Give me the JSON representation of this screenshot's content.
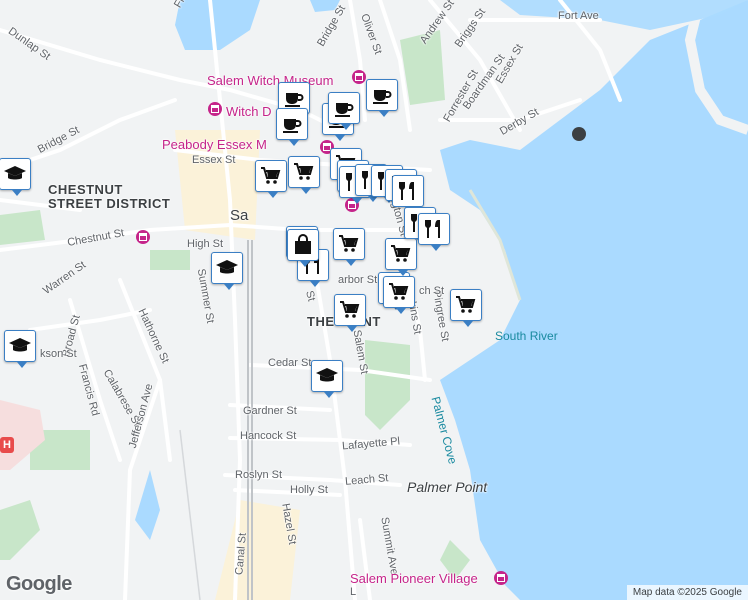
{
  "streets": {
    "franklin": "Franklin",
    "dunlap": "Dunlap St",
    "bridge_nw": "Bridge St",
    "bridge_n": "Bridge St",
    "oliver": "Oliver St",
    "andrew": "Andrew St",
    "briggs": "Briggs St",
    "boardman": "Boardman St",
    "forrester": "Forrester St",
    "essex_ne": "Essex St",
    "fort_ave": "Fort Ave",
    "derby": "Derby St",
    "essex": "Essex St",
    "chestnut": "Chestnut St",
    "high": "High St",
    "warren": "Warren St",
    "summer": "Summer St",
    "hathorne": "Hathorne St",
    "broad": "Broad St",
    "jackson": "kson St",
    "francis": "Francis Rd",
    "calabrese": "Calabrese St",
    "jefferson": "Jefferson Ave",
    "cedar": "Cedar St",
    "salem": "Salem St",
    "gardner": "Gardner St",
    "hancock": "Hancock St",
    "lafayette_pl": "Lafayette Pl",
    "roslyn": "Roslyn St",
    "leach": "Leach St",
    "holly": "Holly St",
    "summit": "Summit Ave",
    "hazel": "Hazel St",
    "canal": "Canal St",
    "pingree": "Pingree St",
    "perkins": "rkins St",
    "harbor": "arbor St",
    "ch": "ch St",
    "lafayette": "ngton St",
    "st": "St",
    "l": "L",
    "sa": "Sa",
    "u": "U"
  },
  "pois": {
    "witch_museum": "Salem Witch Museum",
    "witch_d": "Witch D",
    "peabody": "Peabody Essex M",
    "pioneer": "Salem Pioneer Village"
  },
  "areas": {
    "chestnut_1": "CHESTNUT",
    "chestnut_2": "STREET DISTRICT",
    "the_point": "THE POINT",
    "palmer_point": "Palmer Point",
    "south_river": "South River",
    "palmer_cove": "Palmer Cove"
  },
  "branding": {
    "logo": "Google",
    "attribution": "Map data ©2025 Google",
    "hospital_glyph": "H"
  },
  "colors": {
    "water": "#aadaff",
    "park": "#c8e6c9",
    "road": "#ffffff",
    "pin_border": "#3b7fc4",
    "museum": "#c5248a"
  },
  "markers": [
    {
      "icon": "coffee-icon"
    },
    {
      "icon": "coffee-icon"
    },
    {
      "icon": "coffee-icon"
    },
    {
      "icon": "coffee-icon"
    },
    {
      "icon": "coffee-icon"
    },
    {
      "icon": "grocery-cart-icon"
    },
    {
      "icon": "grocery-cart-icon"
    },
    {
      "icon": "grocery-cart-icon"
    },
    {
      "icon": "grocery-cart-icon"
    },
    {
      "icon": "grocery-cart-icon"
    },
    {
      "icon": "grocery-cart-icon"
    },
    {
      "icon": "grocery-cart-icon"
    },
    {
      "icon": "grocery-cart-icon"
    },
    {
      "icon": "grocery-cart-icon"
    },
    {
      "icon": "grocery-cart-icon"
    },
    {
      "icon": "restaurant-icon"
    },
    {
      "icon": "restaurant-icon"
    },
    {
      "icon": "restaurant-icon"
    },
    {
      "icon": "restaurant-icon"
    },
    {
      "icon": "restaurant-icon"
    },
    {
      "icon": "restaurant-icon"
    },
    {
      "icon": "restaurant-icon"
    },
    {
      "icon": "restaurant-icon"
    },
    {
      "icon": "restaurant-icon"
    },
    {
      "icon": "shopping-bag-icon"
    },
    {
      "icon": "school-icon"
    },
    {
      "icon": "school-icon"
    },
    {
      "icon": "school-icon"
    },
    {
      "icon": "school-icon"
    }
  ]
}
